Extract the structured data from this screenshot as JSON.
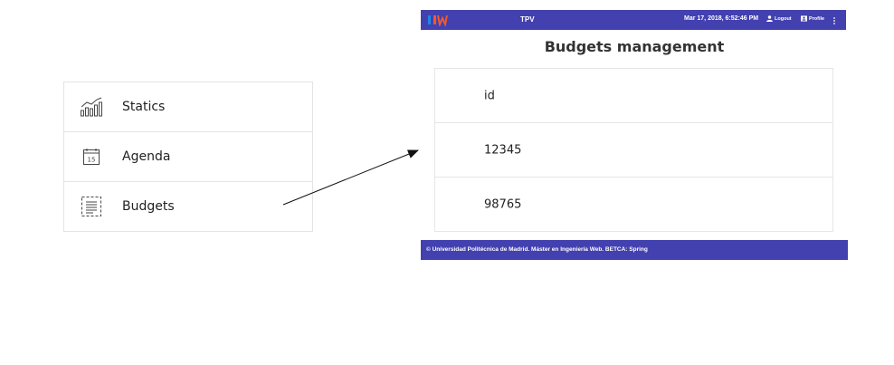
{
  "menu": {
    "items": [
      {
        "label": "Statics",
        "icon": "bar-chart-icon"
      },
      {
        "label": "Agenda",
        "icon": "calendar-icon",
        "calendar_day": "15"
      },
      {
        "label": "Budgets",
        "icon": "document-list-icon"
      }
    ]
  },
  "app": {
    "title": "TPV",
    "datetime": "Mar 17, 2018, 6:52:46 PM",
    "logout_label": "Logout",
    "profile_label": "Profile",
    "page_title": "Budgets management",
    "table": {
      "header": "id",
      "rows": [
        "12345",
        "98765"
      ]
    },
    "footer": "© Universidad Politécnica de Madrid. Máster en Ingeniería Web. BETCA: Spring"
  },
  "colors": {
    "bar": "#4340b0",
    "logo_primary": "#f05a28",
    "logo_secondary": "#1e88e5"
  }
}
